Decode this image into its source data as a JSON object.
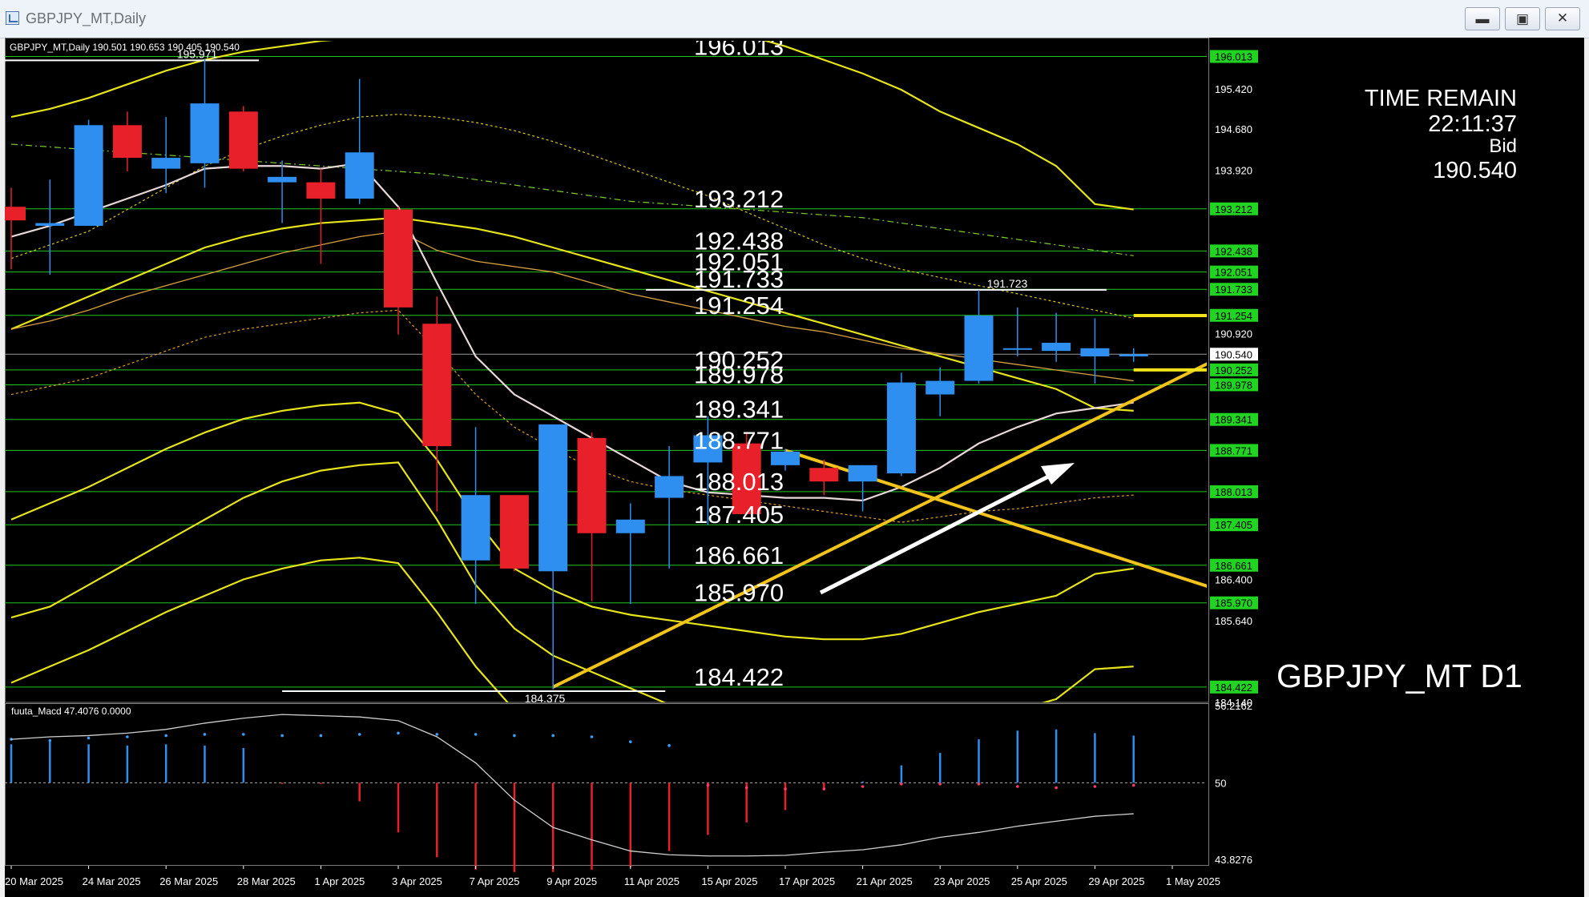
{
  "window": {
    "title": "GBPJPY_MT,Daily",
    "controls": {
      "minimize": "▬",
      "restore": "▣",
      "close": "✕"
    }
  },
  "symbol_header": {
    "symbol": "GBPJPY_MT,Daily",
    "open": "190.501",
    "high": "190.653",
    "low": "190.405",
    "close": "190.540"
  },
  "info_panel": {
    "time_remain_label": "TIME REMAIN",
    "time_remain": "22:11:37",
    "bid_label": "Bid",
    "bid": "190.540"
  },
  "watermark": "GBPJPY_MT D1",
  "indicator": {
    "name": "fuuta_Macd",
    "value": "47.4076",
    "value2": "0.0000"
  },
  "colors": {
    "background": "#000000",
    "bull": "#2e8ff0",
    "bear": "#e8202a",
    "level": "#22c422",
    "level_label_bg": "#22d422",
    "band": "#e6e41a",
    "trend": "#f2c31a",
    "ma_fast": "#e8d8d8",
    "arrow": "#ffffff",
    "axis_text": "#ffffff"
  },
  "chart_data": {
    "type": "candlestick",
    "timeframe": "Daily",
    "x_ticks": [
      "20 Mar 2025",
      "24 Mar 2025",
      "26 Mar 2025",
      "28 Mar 2025",
      "1 Apr 2025",
      "3 Apr 2025",
      "7 Apr 2025",
      "9 Apr 2025",
      "11 Apr 2025",
      "15 Apr 2025",
      "17 Apr 2025",
      "21 Apr 2025",
      "23 Apr 2025",
      "25 Apr 2025",
      "29 Apr 2025",
      "1 May 2025"
    ],
    "y_ticks": [
      "196.013",
      "195.420",
      "194.680",
      "193.920",
      "193.212",
      "192.438",
      "192.051",
      "191.733",
      "191.254",
      "190.920",
      "190.540",
      "190.252",
      "189.978",
      "189.341",
      "188.771",
      "188.013",
      "187.405",
      "186.661",
      "186.400",
      "185.970",
      "185.640",
      "184.422",
      "184.140"
    ],
    "ylim": [
      184.14,
      196.3
    ],
    "candles": [
      {
        "o": 193.25,
        "h": 193.6,
        "l": 192.1,
        "c": 193.0
      },
      {
        "o": 192.9,
        "h": 193.75,
        "l": 192.0,
        "c": 192.95
      },
      {
        "o": 192.9,
        "h": 194.85,
        "l": 192.9,
        "c": 194.75
      },
      {
        "o": 194.75,
        "h": 195.0,
        "l": 193.9,
        "c": 194.15
      },
      {
        "o": 193.95,
        "h": 194.9,
        "l": 193.5,
        "c": 194.15
      },
      {
        "o": 194.05,
        "h": 195.97,
        "l": 193.6,
        "c": 195.15
      },
      {
        "o": 195.0,
        "h": 195.1,
        "l": 193.9,
        "c": 193.95
      },
      {
        "o": 193.7,
        "h": 194.1,
        "l": 192.95,
        "c": 193.8
      },
      {
        "o": 193.7,
        "h": 193.95,
        "l": 192.2,
        "c": 193.4
      },
      {
        "o": 193.4,
        "h": 195.6,
        "l": 193.3,
        "c": 194.25
      },
      {
        "o": 193.2,
        "h": 193.25,
        "l": 190.9,
        "c": 191.4
      },
      {
        "o": 191.1,
        "h": 191.6,
        "l": 187.65,
        "c": 188.85
      },
      {
        "o": 186.75,
        "h": 189.2,
        "l": 185.95,
        "c": 187.95
      },
      {
        "o": 187.95,
        "h": 187.95,
        "l": 186.55,
        "c": 186.6
      },
      {
        "o": 186.55,
        "h": 189.25,
        "l": 184.38,
        "c": 189.25
      },
      {
        "o": 189.0,
        "h": 189.1,
        "l": 186.0,
        "c": 187.25
      },
      {
        "o": 187.25,
        "h": 187.8,
        "l": 185.95,
        "c": 187.5
      },
      {
        "o": 187.9,
        "h": 188.85,
        "l": 186.6,
        "c": 188.3
      },
      {
        "o": 188.55,
        "h": 189.4,
        "l": 187.4,
        "c": 189.05
      },
      {
        "o": 188.9,
        "h": 189.1,
        "l": 187.6,
        "c": 187.6
      },
      {
        "o": 188.5,
        "h": 188.8,
        "l": 188.4,
        "c": 188.75
      },
      {
        "o": 188.45,
        "h": 188.6,
        "l": 187.95,
        "c": 188.2
      },
      {
        "o": 188.2,
        "h": 188.5,
        "l": 187.65,
        "c": 188.5
      },
      {
        "o": 188.35,
        "h": 190.2,
        "l": 188.3,
        "c": 190.02
      },
      {
        "o": 189.8,
        "h": 190.3,
        "l": 189.4,
        "c": 190.05
      },
      {
        "o": 190.05,
        "h": 191.72,
        "l": 190.0,
        "c": 191.25
      },
      {
        "o": 190.65,
        "h": 191.4,
        "l": 190.5,
        "c": 190.65
      },
      {
        "o": 190.6,
        "h": 191.3,
        "l": 190.4,
        "c": 190.75
      },
      {
        "o": 190.5,
        "h": 191.2,
        "l": 190.0,
        "c": 190.65
      },
      {
        "o": 190.5,
        "h": 190.65,
        "l": 190.4,
        "c": 190.54
      }
    ],
    "levels": [
      196.013,
      193.212,
      192.438,
      192.051,
      191.733,
      191.254,
      190.252,
      189.978,
      189.341,
      188.771,
      188.013,
      187.405,
      186.661,
      185.97,
      184.422
    ],
    "level_labels_chart": [
      "196.013",
      "193.212",
      "192.438",
      "192.051",
      "191.733",
      "191.254",
      "190.252",
      "189.978",
      "189.341",
      "188.771",
      "188.013",
      "187.405",
      "186.661",
      "185.970",
      "184.422"
    ],
    "current_price": 190.54,
    "high_marker": {
      "value": 195.971,
      "label": "195.971"
    },
    "low_marker": {
      "value": 184.375,
      "label": "184.375"
    },
    "swing_marker": {
      "value": 191.723,
      "label": "191.723"
    },
    "overlay_series": {
      "ma_fast": [
        192.7,
        192.9,
        193.15,
        193.4,
        193.65,
        193.95,
        194.0,
        194.0,
        193.95,
        194.05,
        193.25,
        191.85,
        190.5,
        189.8,
        189.4,
        189.0,
        188.6,
        188.2,
        188.0,
        187.95,
        187.9,
        187.9,
        187.85,
        188.1,
        188.45,
        188.9,
        189.2,
        189.45,
        189.55,
        189.65
      ],
      "ma_slow": [
        191.0,
        191.15,
        191.35,
        191.6,
        191.8,
        192.0,
        192.2,
        192.4,
        192.55,
        192.7,
        192.8,
        192.45,
        192.25,
        192.15,
        192.05,
        191.85,
        191.65,
        191.5,
        191.35,
        191.2,
        191.05,
        190.95,
        190.8,
        190.65,
        190.55,
        190.45,
        190.35,
        190.25,
        190.15,
        190.05
      ],
      "ma_dashed_orange": [
        189.8,
        189.95,
        190.1,
        190.35,
        190.6,
        190.85,
        191.0,
        191.1,
        191.2,
        191.3,
        191.35,
        190.6,
        189.8,
        189.2,
        188.8,
        188.45,
        188.2,
        188.05,
        187.95,
        187.85,
        187.75,
        187.65,
        187.55,
        187.45,
        187.55,
        187.65,
        187.7,
        187.8,
        187.9,
        187.95
      ],
      "ma_dashed_green": [
        194.4,
        194.35,
        194.3,
        194.25,
        194.2,
        194.15,
        194.1,
        194.05,
        194.0,
        193.95,
        193.9,
        193.85,
        193.75,
        193.65,
        193.55,
        193.45,
        193.35,
        193.3,
        193.25,
        193.2,
        193.15,
        193.1,
        193.05,
        192.95,
        192.85,
        192.75,
        192.65,
        192.55,
        192.45,
        192.35
      ],
      "ma_dashed_yellow": [
        192.3,
        192.55,
        192.8,
        193.2,
        193.6,
        194.0,
        194.3,
        194.55,
        194.75,
        194.9,
        194.95,
        194.9,
        194.8,
        194.65,
        194.45,
        194.2,
        193.95,
        193.7,
        193.45,
        193.15,
        192.85,
        192.55,
        192.3,
        192.1,
        191.95,
        191.8,
        191.65,
        191.5,
        191.35,
        191.2
      ],
      "band_upper_outer": [
        194.9,
        195.05,
        195.25,
        195.5,
        195.75,
        195.95,
        196.1,
        196.2,
        196.3,
        196.35,
        196.4,
        196.45,
        196.5,
        196.5,
        196.55,
        196.6,
        196.7,
        196.7,
        196.6,
        196.4,
        196.2,
        195.95,
        195.7,
        195.4,
        195.0,
        194.7,
        194.4,
        194.0,
        193.3,
        193.2
      ],
      "band_upper_inner": [
        191.0,
        191.3,
        191.6,
        191.9,
        192.2,
        192.5,
        192.7,
        192.85,
        192.95,
        193.0,
        193.05,
        192.95,
        192.85,
        192.7,
        192.5,
        192.3,
        192.1,
        191.9,
        191.7,
        191.5,
        191.3,
        191.1,
        190.9,
        190.7,
        190.5,
        190.3,
        190.1,
        189.9,
        189.55,
        189.5
      ],
      "band_mid": [
        187.5,
        187.8,
        188.1,
        188.45,
        188.8,
        189.1,
        189.35,
        189.5,
        189.6,
        189.65,
        189.45,
        188.6,
        187.5,
        186.6,
        186.2,
        185.9,
        185.75,
        185.65,
        185.55,
        185.45,
        185.35,
        185.3,
        185.3,
        185.4,
        185.6,
        185.8,
        185.95,
        186.1,
        186.5,
        186.6
      ],
      "band_lower_inner": [
        185.7,
        185.9,
        186.3,
        186.7,
        187.1,
        187.5,
        187.9,
        188.2,
        188.4,
        188.5,
        188.55,
        187.5,
        186.3,
        185.5,
        185.0,
        184.7,
        184.4,
        184.1,
        183.9,
        183.7,
        183.55,
        183.45,
        183.35,
        183.45,
        183.6,
        183.8,
        184.0,
        184.2,
        184.75,
        184.8
      ],
      "band_lower_outer": [
        184.5,
        184.8,
        185.1,
        185.45,
        185.8,
        186.1,
        186.4,
        186.6,
        186.75,
        186.8,
        186.7,
        185.8,
        184.8,
        184.0,
        183.6,
        183.3,
        183.1,
        182.9,
        182.75,
        182.6,
        182.5,
        182.45,
        182.45,
        182.5,
        182.6,
        182.8,
        183.0,
        183.2,
        183.6,
        183.7
      ]
    },
    "trendlines": [
      {
        "name": "support-trendline",
        "from": [
          14,
          184.422
        ],
        "to": [
          39,
          193.212
        ]
      },
      {
        "name": "resistance-trendline",
        "from": [
          20,
          188.771
        ],
        "to": [
          39,
          184.422
        ]
      }
    ],
    "short_bars": [
      {
        "name": "yellow-bar-upper",
        "from": 29,
        "to": 31.3,
        "value": 191.25
      },
      {
        "name": "yellow-bar-lower",
        "from": 29,
        "to": 31.0,
        "value": 190.252
      }
    ],
    "macd": {
      "name": "fuuta_Macd",
      "ylim": [
        43.8276,
        56.2162
      ],
      "y_ticks": [
        "56.2162",
        "50",
        "43.8276"
      ],
      "histogram": [
        3.1,
        3.3,
        3.1,
        3.0,
        3.1,
        3.0,
        2.8,
        -0.1,
        -0.1,
        -1.5,
        -4.0,
        -6.0,
        -7.0,
        -7.2,
        -7.2,
        -7.0,
        -6.8,
        -5.5,
        -4.2,
        -3.2,
        -2.2,
        -0.6,
        0.1,
        1.4,
        2.4,
        3.5,
        4.2,
        4.3,
        4.0,
        3.8
      ],
      "signal": [
        3.5,
        3.7,
        3.8,
        4.0,
        4.3,
        4.8,
        5.2,
        5.5,
        5.4,
        5.3,
        5.0,
        3.7,
        1.6,
        -1.4,
        -3.6,
        -4.6,
        -5.5,
        -5.8,
        -5.9,
        -5.9,
        -5.85,
        -5.6,
        -5.4,
        -5.0,
        -4.4,
        -4.0,
        -3.5,
        -3.1,
        -2.7,
        -2.5
      ],
      "dot_levels": [
        3.5,
        3.4,
        3.6,
        3.7,
        3.8,
        3.9,
        3.9,
        3.8,
        3.8,
        3.9,
        4.0,
        3.9,
        3.9,
        3.8,
        3.8,
        3.7,
        3.3,
        3.0,
        -0.2,
        -0.4,
        -0.5,
        -0.5,
        -0.3,
        -0.1,
        -0.1,
        -0.1,
        -0.3,
        -0.4,
        -0.3,
        -0.2
      ]
    }
  }
}
